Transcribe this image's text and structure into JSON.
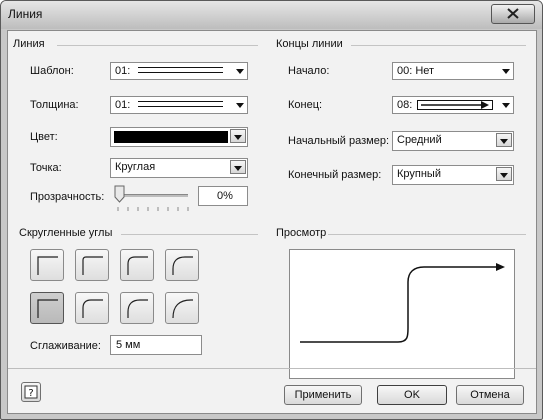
{
  "window": {
    "title": "Линия"
  },
  "line_section": {
    "heading": "Линия",
    "pattern_label": "Шаблон:",
    "pattern_value": "01:",
    "weight_label": "Толщина:",
    "weight_value": "01:",
    "color_label": "Цвет:",
    "color_value": "#000000",
    "cap_label": "Точка:",
    "cap_value": "Круглая",
    "transparency_label": "Прозрачность:",
    "transparency_value": "0%",
    "transparency_level": 0
  },
  "line_ends": {
    "heading": "Концы линии",
    "begin_label": "Начало:",
    "begin_value": "00: Нет",
    "end_label": "Конец:",
    "end_value": "08:",
    "begin_size_label": "Начальный размер:",
    "begin_size_value": "Средний",
    "end_size_label": "Конечный размер:",
    "end_size_value": "Крупный"
  },
  "rounded_corners": {
    "heading": "Скругленные углы",
    "selected_index": 4,
    "options": [
      "corner-0",
      "corner-1",
      "corner-2",
      "corner-3",
      "corner-4",
      "corner-5",
      "corner-6",
      "corner-7"
    ],
    "smoothing_label": "Сглаживание:",
    "smoothing_value": "5 мм"
  },
  "preview": {
    "heading": "Просмотр"
  },
  "buttons": {
    "help_icon": "help-icon",
    "apply": "Применить",
    "ok": "OK",
    "cancel": "Отмена"
  }
}
